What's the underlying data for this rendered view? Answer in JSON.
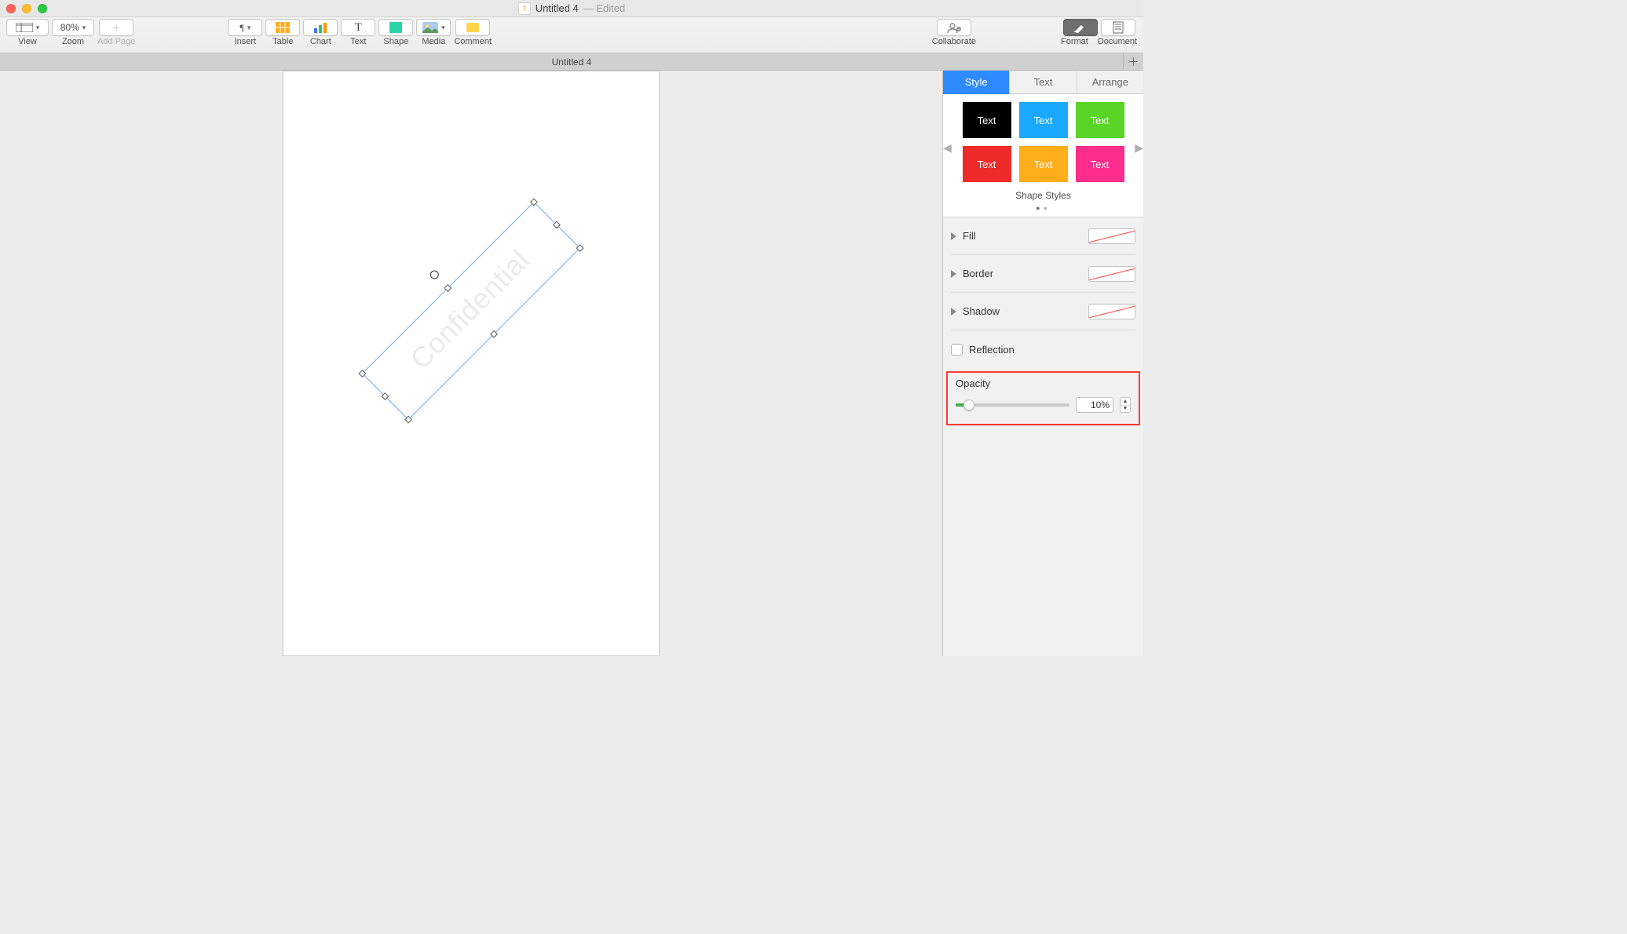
{
  "window": {
    "title": "Untitled 4",
    "status": "— Edited",
    "icon_char": "7"
  },
  "toolbar": {
    "view": "View",
    "zoom_label": "Zoom",
    "zoom_value": "80%",
    "add_page": "Add Page",
    "insert": "Insert",
    "table": "Table",
    "chart": "Chart",
    "text": "Text",
    "shape": "Shape",
    "media": "Media",
    "comment": "Comment",
    "collaborate": "Collaborate",
    "format": "Format",
    "document": "Document"
  },
  "tabs": {
    "active": "Untitled 4"
  },
  "canvas": {
    "watermark_text": "Confidential"
  },
  "inspector": {
    "tabs": {
      "style": "Style",
      "text": "Text",
      "arrange": "Arrange"
    },
    "swatch_label": "Text",
    "shape_styles_label": "Shape Styles",
    "fill": "Fill",
    "border": "Border",
    "shadow": "Shadow",
    "reflection": "Reflection",
    "opacity_label": "Opacity",
    "opacity_value": "10%"
  }
}
